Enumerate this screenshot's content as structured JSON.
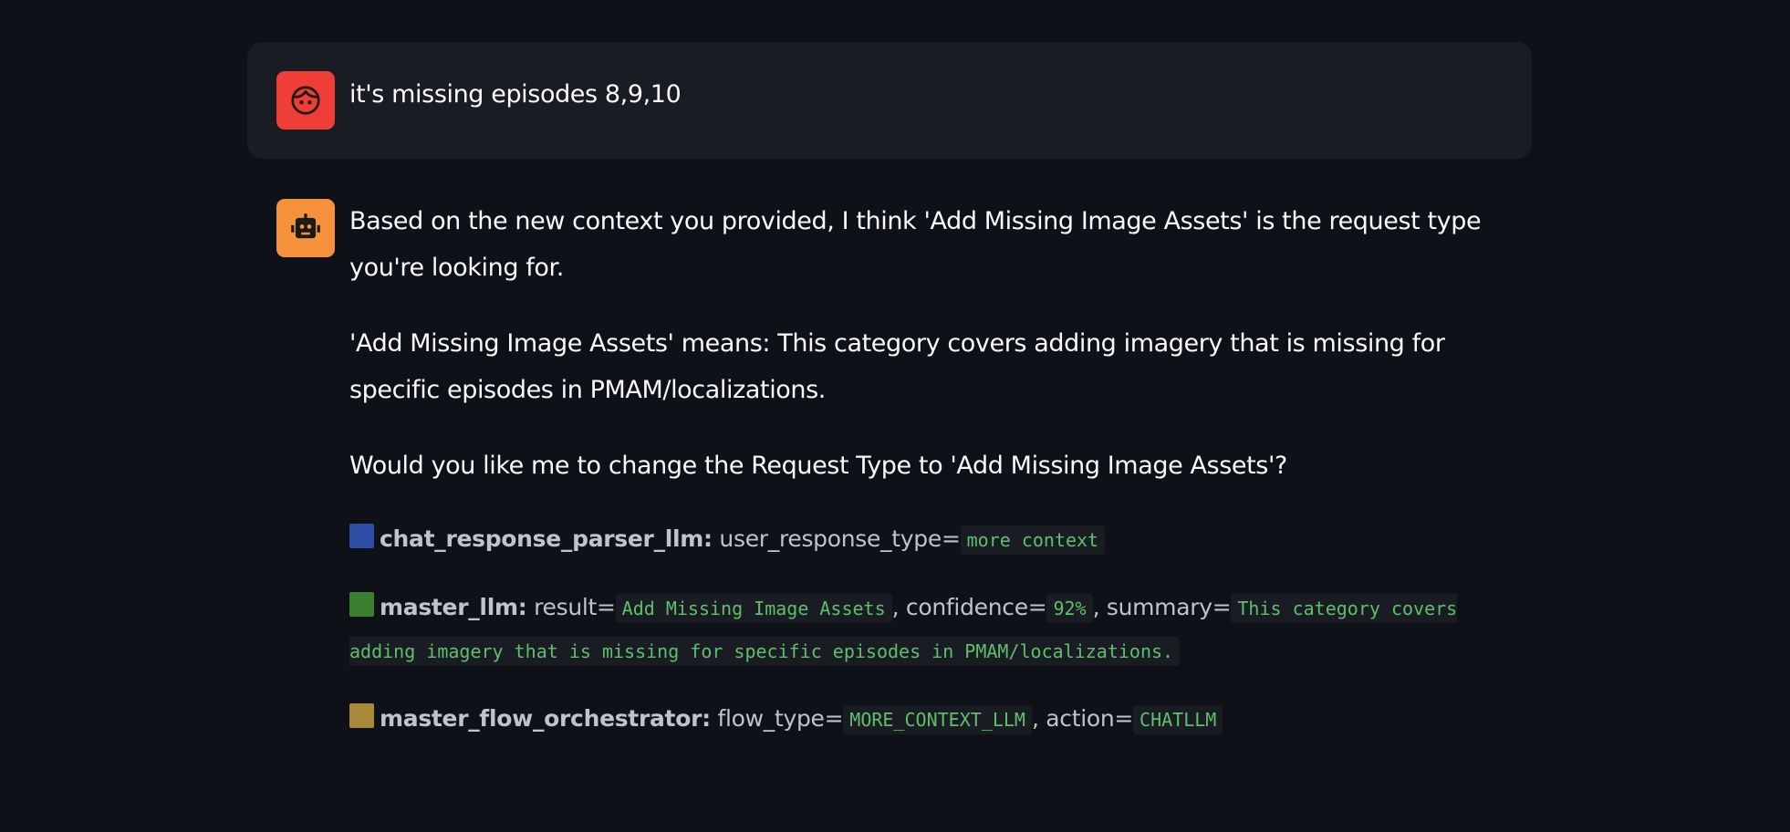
{
  "messages": {
    "user": {
      "avatar_icon": "user-face-icon",
      "avatar_color": "#ee3e36",
      "text": "it's missing episodes 8,9,10"
    },
    "assistant": {
      "avatar_icon": "robot-icon",
      "avatar_color": "#f6923c",
      "paragraphs": [
        "Based on the new context you provided, I think 'Add Missing Image Assets' is the request type you're looking for.",
        "'Add Missing Image Assets' means: This category covers adding imagery that is missing for specific episodes in PMAM/localizations.",
        "Would you like me to change the Request Type to 'Add Missing Image Assets'?"
      ],
      "debug": [
        {
          "color": "#2e4da5",
          "agent": "chat_response_parser_llm:",
          "fields": [
            {
              "label": "user_response_type=",
              "value": "more context"
            }
          ]
        },
        {
          "color": "#3c7f2e",
          "agent": "master_llm:",
          "fields": [
            {
              "label": "result=",
              "value": "Add Missing Image Assets"
            },
            {
              "label": ", confidence=",
              "value": "92%"
            },
            {
              "label": ", summary=",
              "value": "This category covers adding imagery that is missing for specific episodes in PMAM/localizations."
            }
          ]
        },
        {
          "color": "#a8893a",
          "agent": "master_flow_orchestrator:",
          "fields": [
            {
              "label": "flow_type=",
              "value": "MORE_CONTEXT_LLM"
            },
            {
              "label": ", action=",
              "value": "CHATLLM"
            }
          ]
        }
      ]
    }
  }
}
